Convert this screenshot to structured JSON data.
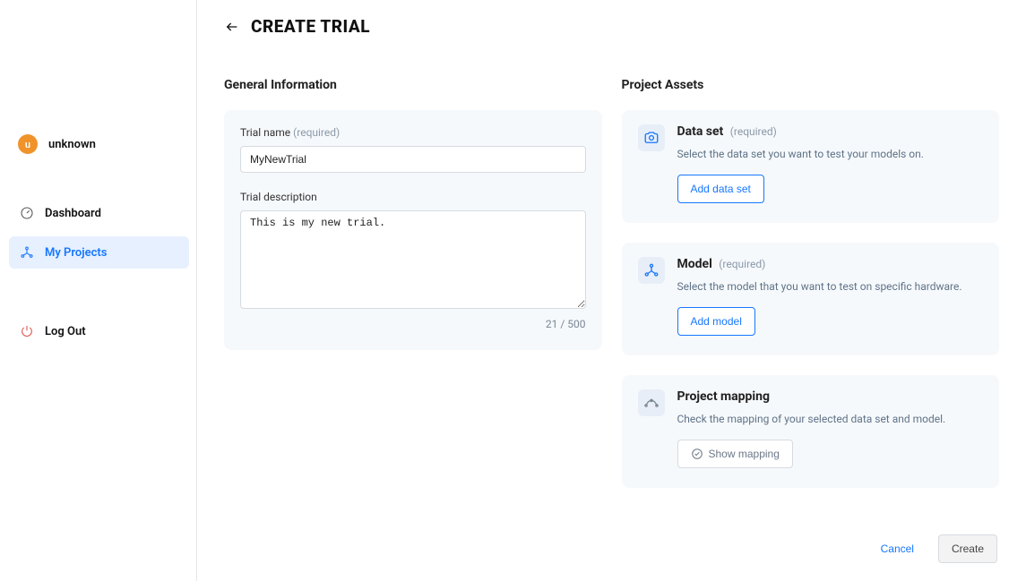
{
  "user": {
    "avatar_letter": "u",
    "name": "unknown"
  },
  "nav": {
    "dashboard_label": "Dashboard",
    "projects_label": "My Projects",
    "logout_label": "Log Out"
  },
  "header": {
    "title": "CREATE TRIAL"
  },
  "general": {
    "section_title": "General Information",
    "trial_name_label": "Trial name",
    "trial_name_required": "(required)",
    "trial_name_value": "MyNewTrial",
    "trial_desc_label": "Trial description",
    "trial_desc_value": "This is my new trial.",
    "counter": "21 / 500"
  },
  "assets": {
    "section_title": "Project Assets",
    "dataset": {
      "title": "Data set",
      "required": "(required)",
      "desc": "Select the data set you want to test your models on.",
      "button": "Add data set"
    },
    "model": {
      "title": "Model",
      "required": "(required)",
      "desc": "Select the model that you want to test on specific hardware.",
      "button": "Add model"
    },
    "mapping": {
      "title": "Project mapping",
      "desc": "Check the mapping of your selected data set and model.",
      "button": "Show mapping"
    }
  },
  "footer": {
    "cancel": "Cancel",
    "create": "Create"
  }
}
